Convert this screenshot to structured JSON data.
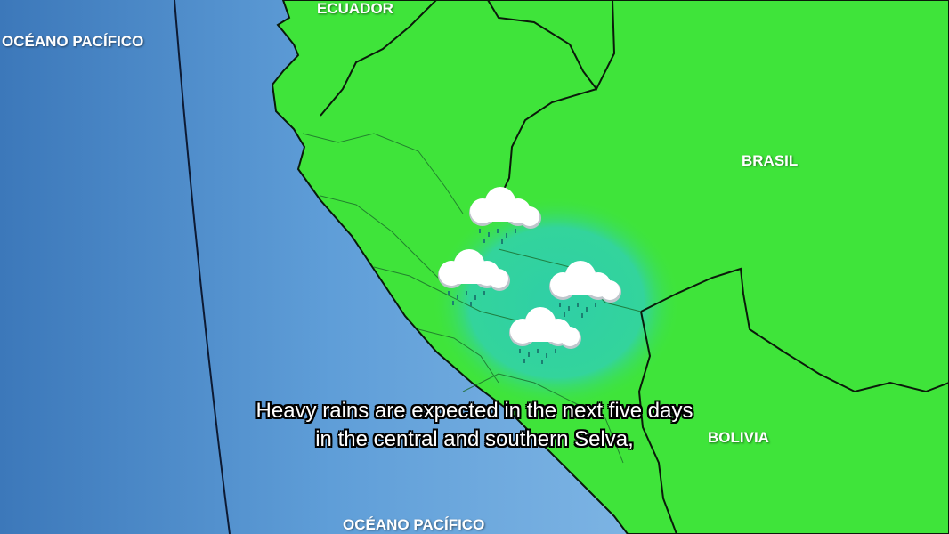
{
  "labels": {
    "ocean_top_left": "OCÉANO PACÍFICO",
    "ocean_bottom": "OCÉANO PACÍFICO",
    "ecuador": "ECUADOR",
    "brasil": "BRASIL",
    "bolivia": "BOLIVIA"
  },
  "subtitle": {
    "line1": "Heavy rains are expected in the next five days",
    "line2": "in the central and southern Selva,"
  },
  "weather_icons": [
    "rain-cloud",
    "rain-cloud",
    "rain-cloud",
    "rain-cloud"
  ],
  "colors": {
    "land": "#3fe43a",
    "ocean": "#6aa6dc",
    "rain_zone": "#2fcfa6",
    "border": "#0a1a0a"
  }
}
